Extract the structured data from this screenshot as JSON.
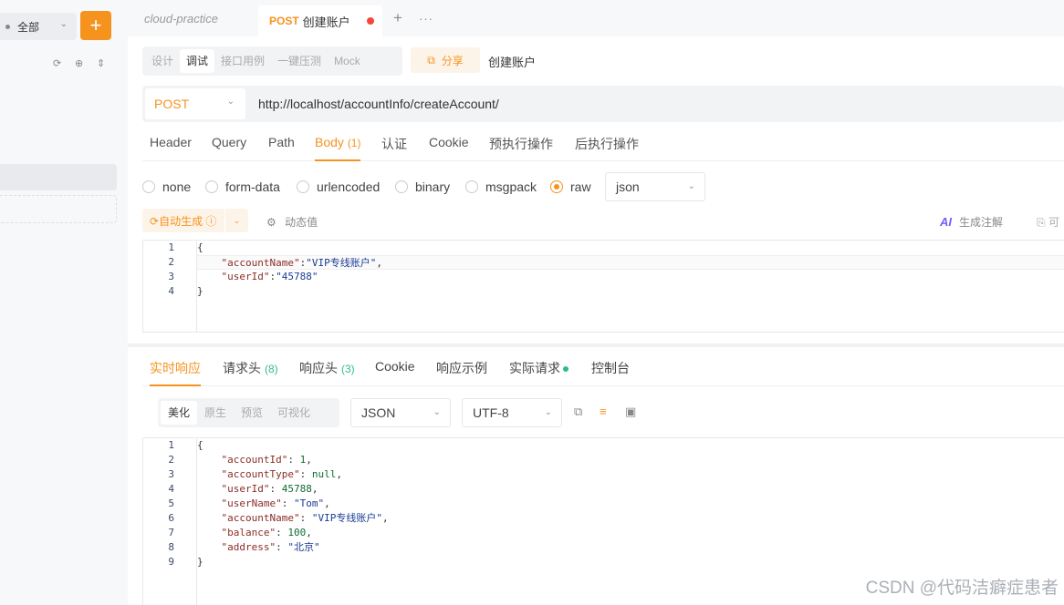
{
  "sidebar": {
    "filter_label": "全部",
    "add_label": "+"
  },
  "tabs": {
    "collection": "cloud-practice",
    "active_method": "POST",
    "active_name": "创建账户",
    "new_tab": "+",
    "more": "···"
  },
  "modes": [
    "设计",
    "调试",
    "接口用例",
    "一键压测",
    "Mock"
  ],
  "share": {
    "label": "分享"
  },
  "endpoint_name": "创建账户",
  "request": {
    "method": "POST",
    "url": "http://localhost/accountInfo/createAccount/",
    "tabs": [
      "Header",
      "Query",
      "Path",
      "Body",
      "认证",
      "Cookie",
      "预执行操作",
      "后执行操作"
    ],
    "body_badge": "(1)",
    "body_types": [
      "none",
      "form-data",
      "urlencoded",
      "binary",
      "msgpack",
      "raw"
    ],
    "body_format": "json",
    "auto_generate": "自动生成",
    "dynamic_value": "动态值",
    "ai_label": "AI",
    "generate_comment": "生成注解",
    "copy_label": "可"
  },
  "request_body": {
    "line_numbers": [
      "1",
      "2",
      "3",
      "4"
    ],
    "lines": [
      [
        {
          "t": "{",
          "c": ""
        }
      ],
      [
        {
          "t": "    ",
          "c": ""
        },
        {
          "t": "\"accountName\"",
          "c": "k"
        },
        {
          "t": ":",
          "c": ""
        },
        {
          "t": "\"VIP专线账户\"",
          "c": "s"
        },
        {
          "t": ",",
          "c": ""
        }
      ],
      [
        {
          "t": "    ",
          "c": ""
        },
        {
          "t": "\"userId\"",
          "c": "k"
        },
        {
          "t": ":",
          "c": ""
        },
        {
          "t": "\"45788\"",
          "c": "s"
        }
      ],
      [
        {
          "t": "}",
          "c": ""
        }
      ]
    ]
  },
  "response": {
    "tabs": [
      {
        "label": "实时响应",
        "count": ""
      },
      {
        "label": "请求头",
        "count": "(8)"
      },
      {
        "label": "响应头",
        "count": "(3)"
      },
      {
        "label": "Cookie",
        "count": ""
      },
      {
        "label": "响应示例",
        "count": ""
      },
      {
        "label": "实际请求",
        "count": ""
      },
      {
        "label": "控制台",
        "count": ""
      }
    ],
    "views": [
      "美化",
      "原生",
      "预览",
      "可视化"
    ],
    "format": "JSON",
    "encoding": "UTF-8"
  },
  "response_body": {
    "line_numbers": [
      "1",
      "2",
      "3",
      "4",
      "5",
      "6",
      "7",
      "8",
      "9"
    ],
    "lines": [
      [
        {
          "t": "{",
          "c": ""
        }
      ],
      [
        {
          "t": "    ",
          "c": ""
        },
        {
          "t": "\"accountId\"",
          "c": "k"
        },
        {
          "t": ": ",
          "c": ""
        },
        {
          "t": "1",
          "c": "n"
        },
        {
          "t": ",",
          "c": ""
        }
      ],
      [
        {
          "t": "    ",
          "c": ""
        },
        {
          "t": "\"accountType\"",
          "c": "k"
        },
        {
          "t": ": ",
          "c": ""
        },
        {
          "t": "null",
          "c": "n"
        },
        {
          "t": ",",
          "c": ""
        }
      ],
      [
        {
          "t": "    ",
          "c": ""
        },
        {
          "t": "\"userId\"",
          "c": "k"
        },
        {
          "t": ": ",
          "c": ""
        },
        {
          "t": "45788",
          "c": "n"
        },
        {
          "t": ",",
          "c": ""
        }
      ],
      [
        {
          "t": "    ",
          "c": ""
        },
        {
          "t": "\"userName\"",
          "c": "k"
        },
        {
          "t": ": ",
          "c": ""
        },
        {
          "t": "\"Tom\"",
          "c": "s"
        },
        {
          "t": ",",
          "c": ""
        }
      ],
      [
        {
          "t": "    ",
          "c": ""
        },
        {
          "t": "\"accountName\"",
          "c": "k"
        },
        {
          "t": ": ",
          "c": ""
        },
        {
          "t": "\"VIP专线账户\"",
          "c": "s"
        },
        {
          "t": ",",
          "c": ""
        }
      ],
      [
        {
          "t": "    ",
          "c": ""
        },
        {
          "t": "\"balance\"",
          "c": "k"
        },
        {
          "t": ": ",
          "c": ""
        },
        {
          "t": "100",
          "c": "n"
        },
        {
          "t": ",",
          "c": ""
        }
      ],
      [
        {
          "t": "    ",
          "c": ""
        },
        {
          "t": "\"address\"",
          "c": "k"
        },
        {
          "t": ": ",
          "c": ""
        },
        {
          "t": "\"北京\"",
          "c": "s"
        }
      ],
      [
        {
          "t": "}",
          "c": ""
        }
      ]
    ]
  },
  "watermark": "CSDN @代码洁癖症患者",
  "colors": {
    "accent": "#f6931e",
    "success": "#2bbd86",
    "unsaved_dot": "#f5473b",
    "ai": "#7b5cf5"
  }
}
